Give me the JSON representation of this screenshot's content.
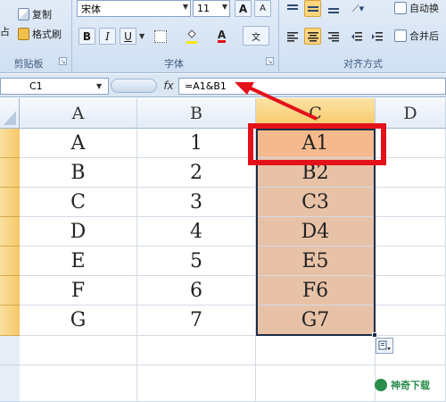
{
  "ribbon": {
    "clipboard": {
      "copy_label": "复制",
      "format_painter_label": "格式刷",
      "paste_fragment": "占",
      "group_label": "剪贴板"
    },
    "font": {
      "font_name": "宋体",
      "font_size": "11",
      "bold": "B",
      "italic": "I",
      "underline": "U",
      "font_color_glyph": "A",
      "wen_glyph": "文",
      "grow_glyph": "A",
      "shrink_glyph": "A",
      "group_label": "字体"
    },
    "alignment": {
      "wrap_text_label": "自动换",
      "merge_label": "合并后",
      "group_label": "对齐方式"
    }
  },
  "formula_bar": {
    "name_box": "C1",
    "fx": "fx",
    "formula": "=A1&B1"
  },
  "grid": {
    "columns": [
      "A",
      "B",
      "C",
      "D"
    ],
    "rows": [
      {
        "a": "A",
        "b": "1",
        "c": "A1"
      },
      {
        "a": "B",
        "b": "2",
        "c": "B2"
      },
      {
        "a": "C",
        "b": "3",
        "c": "C3"
      },
      {
        "a": "D",
        "b": "4",
        "c": "D4"
      },
      {
        "a": "E",
        "b": "5",
        "c": "E5"
      },
      {
        "a": "F",
        "b": "6",
        "c": "F6"
      },
      {
        "a": "G",
        "b": "7",
        "c": "G7"
      }
    ]
  },
  "watermark": {
    "text": "神奇下载"
  },
  "colors": {
    "highlight_red": "#e4101a",
    "selected_cell_fill": "#e8c2a7",
    "active_header": "#f6c866"
  }
}
